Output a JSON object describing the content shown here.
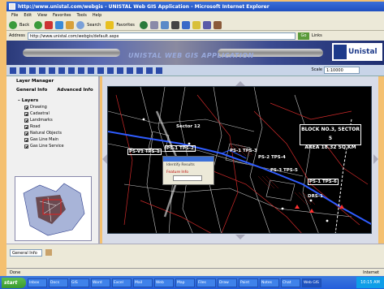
{
  "window": {
    "title": "http://www.unistal.com/webgis - UNISTAL Web GIS Application - Microsoft Internet Explorer"
  },
  "menubar": {
    "items": [
      "File",
      "Edit",
      "View",
      "Favorites",
      "Tools",
      "Help"
    ]
  },
  "toolbar": {
    "back_label": "Back",
    "search_label": "Search",
    "favorites_label": "Favorites"
  },
  "address": {
    "label": "Address",
    "value": "http://www.unistal.com/webgis/default.aspx",
    "go_label": "Go",
    "links_label": "Links"
  },
  "banner": {
    "app_title": "UNISTAL WEB GIS APPLICATION",
    "logo_text": "Unistal"
  },
  "maptools": {
    "scale_label": "Scale",
    "scale_value": "1:10000"
  },
  "leftpanel": {
    "title": "Layer Manager",
    "tabs": [
      "General Info",
      "Advanced Info"
    ],
    "group": "Layers",
    "layers": [
      {
        "name": "Drawing",
        "checked": true
      },
      {
        "name": "Cadastral",
        "checked": true
      },
      {
        "name": "Landmarks",
        "checked": true
      },
      {
        "name": "Road",
        "checked": true
      },
      {
        "name": "Natural Objects",
        "checked": true
      },
      {
        "name": "Gas Line Main",
        "checked": true
      },
      {
        "name": "Gas Line Service",
        "checked": true
      }
    ]
  },
  "map": {
    "infobox_line1": "BLOCK NO.3, SECTOR 5",
    "infobox_line2": "AREA 18.32 SQ KM",
    "labels": [
      {
        "text": "PS-V1 TPS-1",
        "boxed": true
      },
      {
        "text": "PS-1 TPS-2",
        "boxed": true
      },
      {
        "text": "PS-1 TPS-3",
        "boxed": false
      },
      {
        "text": "PS-2 TPS-4",
        "boxed": false
      },
      {
        "text": "PS-3 TPS-5",
        "boxed": false
      },
      {
        "text": "PS-1 TPS-6",
        "boxed": true
      },
      {
        "text": "DRS-1",
        "boxed": false
      },
      {
        "text": "Sector 12",
        "boxed": false
      }
    ],
    "popup_text": "Identify Results",
    "popup_field": "Feature Info"
  },
  "bottom": {
    "select_value": "General Info"
  },
  "status": {
    "text": "Done",
    "zone": "Internet"
  },
  "taskbar": {
    "start_label": "start",
    "tasks": [
      "Inbox",
      "Docs",
      "GIS",
      "Word",
      "Excel",
      "Mail",
      "Web",
      "Map",
      "Files",
      "Draw",
      "Paint",
      "Notes",
      "Chat",
      "Web GIS"
    ],
    "clock": "10:15 AM"
  },
  "colors": {
    "accent": "#3a6fd8",
    "map_background": "#000000",
    "pipeline": "#2f5cff",
    "boundary": "#ff2222"
  }
}
